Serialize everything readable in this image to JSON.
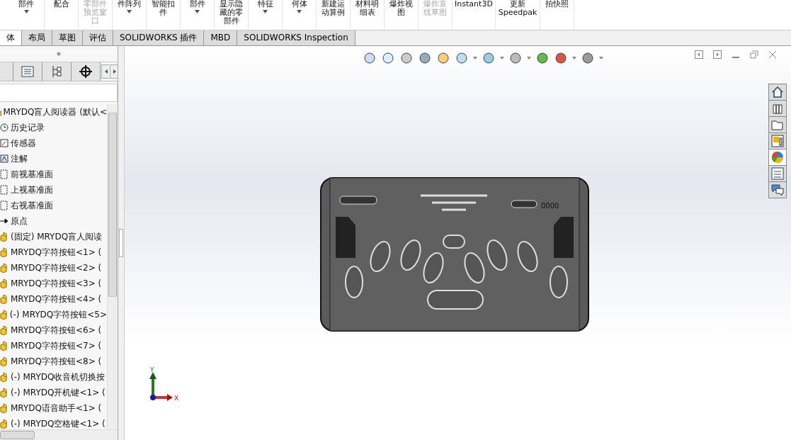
{
  "ribbon": [
    {
      "lines": [
        "部件"
      ],
      "caret": true,
      "disabled": false
    },
    {
      "lines": [
        "配合"
      ],
      "caret": false,
      "disabled": false
    },
    {
      "lines": [
        "零部件",
        "预览窗",
        "口"
      ],
      "caret": false,
      "disabled": true
    },
    {
      "lines": [
        "件阵列"
      ],
      "caret": true,
      "disabled": false
    },
    {
      "lines": [
        "智能扣",
        "件"
      ],
      "caret": false,
      "disabled": false
    },
    {
      "lines": [
        "部件"
      ],
      "caret": true,
      "disabled": false
    },
    {
      "lines": [
        "显示隐",
        "藏的零",
        "部件"
      ],
      "caret": false,
      "disabled": false
    },
    {
      "lines": [
        "特征"
      ],
      "caret": true,
      "disabled": false
    },
    {
      "lines": [
        "何体"
      ],
      "caret": true,
      "disabled": false
    },
    {
      "lines": [
        "新建运",
        "动算例"
      ],
      "caret": false,
      "disabled": false
    },
    {
      "lines": [
        "材料明",
        "细表"
      ],
      "caret": false,
      "disabled": false
    },
    {
      "lines": [
        "爆炸视",
        "图"
      ],
      "caret": false,
      "disabled": false
    },
    {
      "lines": [
        "爆炸直",
        "线草图"
      ],
      "caret": false,
      "disabled": true
    },
    {
      "lines": [
        "Instant3D"
      ],
      "caret": false,
      "disabled": false
    },
    {
      "lines": [
        "更新",
        "Speedpak"
      ],
      "caret": false,
      "disabled": false
    },
    {
      "lines": [
        "拍快照"
      ],
      "caret": false,
      "disabled": false
    }
  ],
  "tabs": [
    {
      "label": "体",
      "selected": true
    },
    {
      "label": "布局",
      "selected": false
    },
    {
      "label": "草图",
      "selected": false
    },
    {
      "label": "评估",
      "selected": false
    },
    {
      "label": "SOLIDWORKS 插件",
      "selected": false
    },
    {
      "label": "MBD",
      "selected": false
    },
    {
      "label": "SOLIDWORKS Inspection",
      "selected": false
    }
  ],
  "tree": {
    "label": "MRYDQ盲人阅读器 (默认<",
    "kind": "assembly",
    "children": [
      {
        "label": "历史记录",
        "kind": "history"
      },
      {
        "label": "传感器",
        "kind": "sensor"
      },
      {
        "label": "注解",
        "kind": "annotation"
      },
      {
        "label": "前视基准面",
        "kind": "plane"
      },
      {
        "label": "上视基准面",
        "kind": "plane"
      },
      {
        "label": "右视基准面",
        "kind": "plane"
      },
      {
        "label": "原点",
        "kind": "origin"
      },
      {
        "label": "(固定) MRYDQ盲人阅读",
        "kind": "part"
      },
      {
        "label": "MRYDQ字符按钮<1> (",
        "kind": "part"
      },
      {
        "label": "MRYDQ字符按钮<2> (",
        "kind": "part"
      },
      {
        "label": "MRYDQ字符按钮<3> (",
        "kind": "part"
      },
      {
        "label": "MRYDQ字符按钮<4> (",
        "kind": "part"
      },
      {
        "label": "(-) MRYDQ字符按钮<5>",
        "kind": "part"
      },
      {
        "label": "MRYDQ字符按钮<6> (",
        "kind": "part"
      },
      {
        "label": "MRYDQ字符按钮<7> (",
        "kind": "part"
      },
      {
        "label": "MRYDQ字符按钮<8> (",
        "kind": "part"
      },
      {
        "label": "(-) MRYDQ收音机切换按",
        "kind": "part"
      },
      {
        "label": "(-) MRYDQ开机键<1> (",
        "kind": "part"
      },
      {
        "label": "MRYDQ语音助手<1> (",
        "kind": "part"
      },
      {
        "label": "(-) MRYDQ空格键<1> (",
        "kind": "part"
      }
    ]
  },
  "triad": {
    "y": "Y",
    "x": "X"
  },
  "model_label": "0000",
  "task_pane": [
    {
      "kind": "home",
      "selected": false
    },
    {
      "kind": "library",
      "selected": false
    },
    {
      "kind": "folder",
      "selected": false
    },
    {
      "kind": "palette",
      "selected": false
    },
    {
      "kind": "appearance",
      "selected": true
    },
    {
      "kind": "properties",
      "selected": false
    },
    {
      "kind": "forum",
      "selected": false
    }
  ]
}
